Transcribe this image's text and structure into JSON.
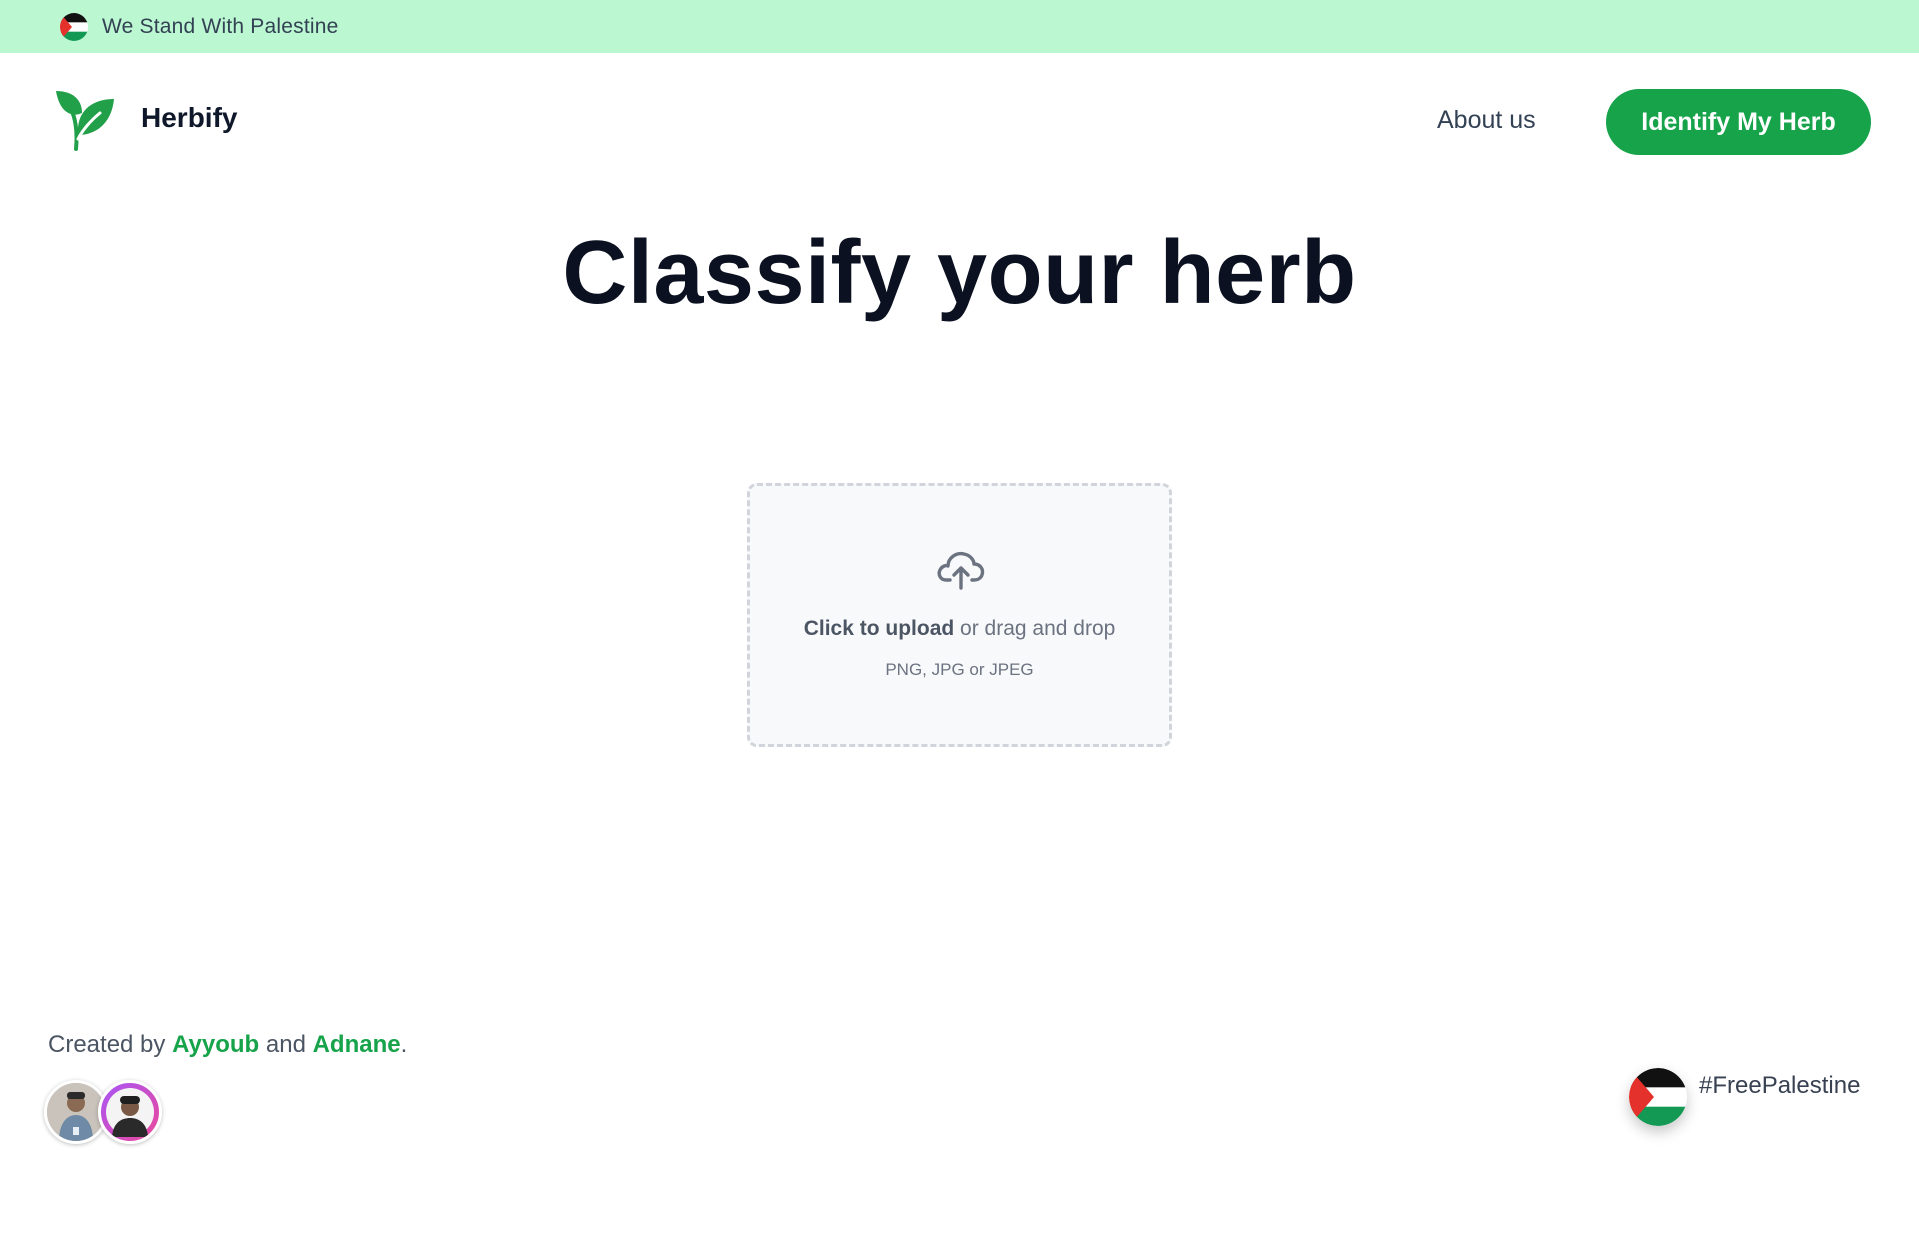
{
  "banner": {
    "text": "We Stand With Palestine",
    "icon": "palestine-flag-icon"
  },
  "header": {
    "brand": "Herbify",
    "logo_icon": "leaf-logo-icon",
    "nav_about": "About us",
    "cta_label": "Identify My Herb"
  },
  "main": {
    "title": "Classify your herb",
    "upload": {
      "icon": "cloud-upload-icon",
      "click_text": "Click to upload",
      "drag_text": " or drag and drop",
      "formats": "PNG, JPG or JPEG"
    }
  },
  "footer": {
    "created_by": "Created by ",
    "author1": "Ayyoub",
    "and": " and ",
    "author2": "Adnane",
    "period": ".",
    "hashtag": "#FreePalestine"
  },
  "colors": {
    "accent": "#16a34a",
    "banner_bg": "#bbf7d0",
    "title": "#0b1120"
  }
}
